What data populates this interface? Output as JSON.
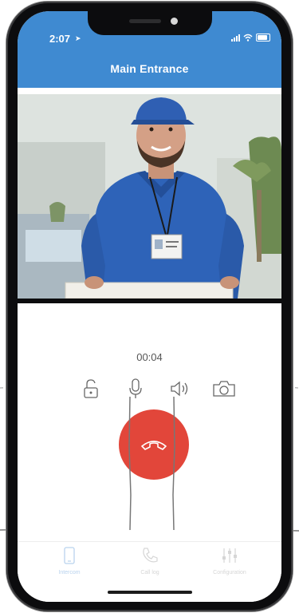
{
  "status_bar": {
    "time": "2:07"
  },
  "header": {
    "title": "Main Entrance"
  },
  "call": {
    "duration": "00:04"
  },
  "controls": [
    {
      "name": "unlock",
      "icon": "unlock-icon"
    },
    {
      "name": "microphone",
      "icon": "microphone-icon"
    },
    {
      "name": "speaker",
      "icon": "speaker-icon"
    },
    {
      "name": "camera",
      "icon": "camera-icon"
    }
  ],
  "hangup": {
    "icon": "hangup-phone-icon",
    "color": "#e2463a"
  },
  "tabbar": {
    "items": [
      {
        "label": "Intercom",
        "icon": "intercom-phone-icon",
        "active": true
      },
      {
        "label": "Call log",
        "icon": "call-log-icon",
        "active": false
      },
      {
        "label": "Configuration",
        "icon": "sliders-icon",
        "active": false
      }
    ]
  },
  "colors": {
    "accent": "#3f8ad1",
    "danger": "#e2463a"
  }
}
